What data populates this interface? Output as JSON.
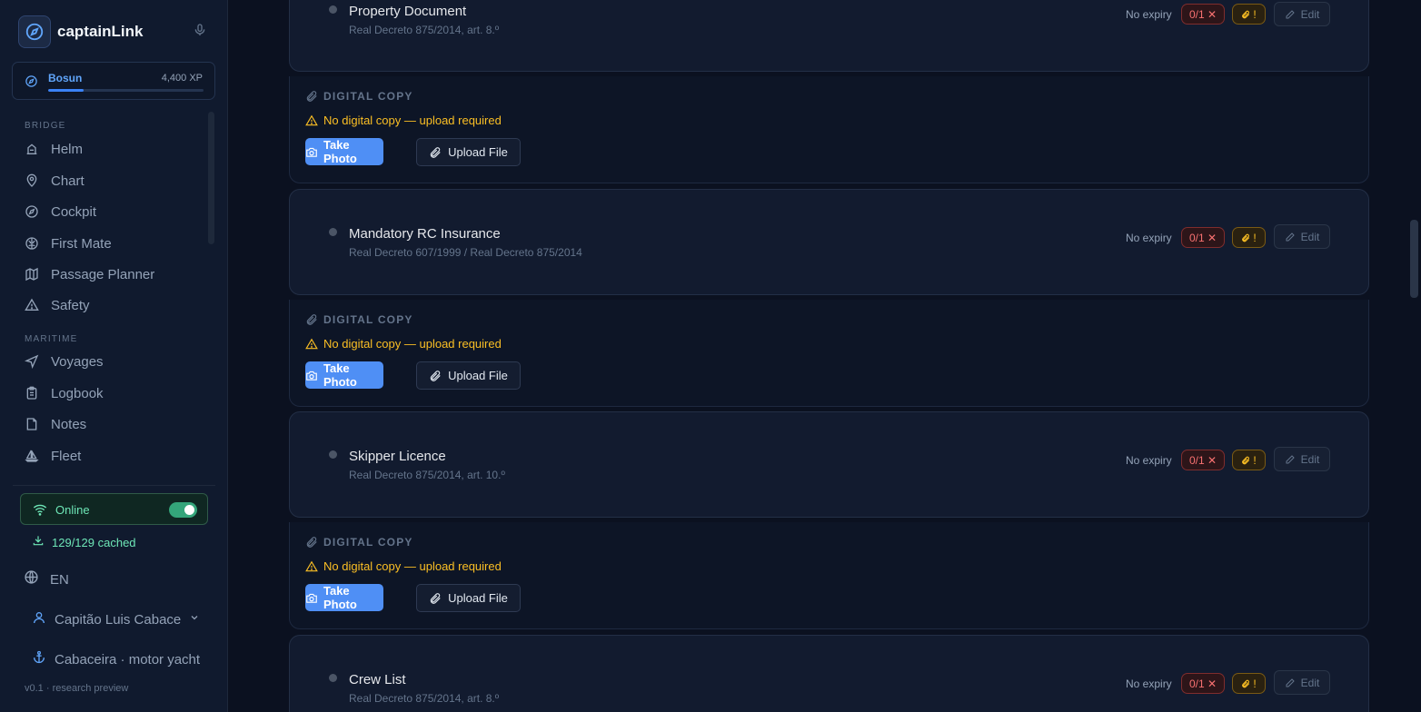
{
  "app": {
    "name": "captainLink",
    "version": "v0.1 · research preview"
  },
  "rank": {
    "name": "Bosun",
    "xp": "4,400 XP",
    "progress": 0.23
  },
  "nav": {
    "bridge_label": "BRIDGE",
    "bridge_items": [
      {
        "label": "Helm",
        "icon": "helm-icon"
      },
      {
        "label": "Chart",
        "icon": "map-pin-icon"
      },
      {
        "label": "Cockpit",
        "icon": "compass-icon"
      },
      {
        "label": "First Mate",
        "icon": "brain-icon"
      },
      {
        "label": "Passage Planner",
        "icon": "map-icon"
      },
      {
        "label": "Safety",
        "icon": "warning-icon"
      }
    ],
    "maritime_label": "MARITIME",
    "maritime_items": [
      {
        "label": "Voyages",
        "icon": "navigation-icon"
      },
      {
        "label": "Logbook",
        "icon": "clipboard-icon"
      },
      {
        "label": "Notes",
        "icon": "note-icon"
      },
      {
        "label": "Fleet",
        "icon": "sailboat-icon"
      }
    ]
  },
  "status": {
    "online": "Online",
    "cached": "129/129 cached",
    "language": "EN"
  },
  "user": {
    "name": "Capitão Luis Cabaceira",
    "vessel": "Cabaceira · motor yacht"
  },
  "common": {
    "no_expiry": "No expiry",
    "count_badge": "0/1 ✕",
    "attach_badge": "!",
    "edit": "Edit",
    "digital_copy": "DIGITAL COPY",
    "warning": "No digital copy — upload required",
    "take_photo": "Take Photo",
    "upload_file": "Upload File"
  },
  "documents": [
    {
      "title": "Property Document",
      "subtitle": "Real Decreto 875/2014, art. 8.º"
    },
    {
      "title": "Mandatory RC Insurance",
      "subtitle": "Real Decreto 607/1999 / Real Decreto 875/2014"
    },
    {
      "title": "Skipper Licence",
      "subtitle": "Real Decreto 875/2014, art. 10.º"
    },
    {
      "title": "Crew List",
      "subtitle": "Real Decreto 875/2014, art. 8.º"
    }
  ],
  "colors": {
    "accent": "#4f8ff5",
    "success": "#34a57a",
    "warning": "#fbbf24",
    "danger": "#f87171"
  }
}
